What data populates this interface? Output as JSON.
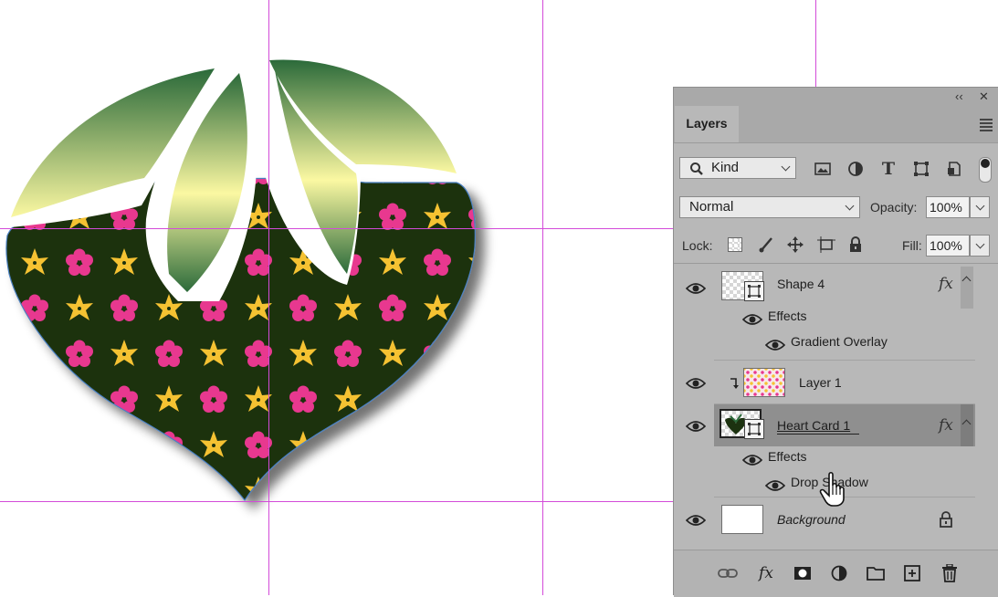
{
  "panel": {
    "title": "Layers",
    "collapse_glyph": "‹‹",
    "close_glyph": "✕",
    "filter_kind": "Kind",
    "blend_mode": "Normal",
    "opacity_label": "Opacity:",
    "opacity_value": "100%",
    "lock_label": "Lock:",
    "fill_label": "Fill:",
    "fill_value": "100%"
  },
  "layers": [
    {
      "name": "Shape 4",
      "fx": "fx",
      "effects_label": "Effects",
      "effect": "Gradient Overlay"
    },
    {
      "name": "Layer 1"
    },
    {
      "name": "Heart Card 1",
      "fx": "fx",
      "effects_label": "Effects",
      "effect": "Drop Shadow",
      "selected": true
    },
    {
      "name": "Background",
      "locked": true
    }
  ],
  "colors": {
    "guide": "#d34bd9",
    "heart_fill": "#1c3210",
    "flower_pink": "#e8378f",
    "flower_yellow": "#f5c233",
    "leaf_dark": "#2b6a3a",
    "leaf_light": "#fbf8a2"
  },
  "icons": [
    "search-icon",
    "image-filter-icon",
    "adjustment-filter-icon",
    "type-filter-icon",
    "shape-filter-icon",
    "smart-object-filter-icon",
    "lock-transparent-icon",
    "lock-paint-icon",
    "lock-move-icon",
    "lock-artboard-icon",
    "lock-all-icon",
    "link-icon",
    "fx-icon",
    "mask-icon",
    "adjustment-icon",
    "folder-icon",
    "new-layer-icon",
    "trash-icon",
    "hand-cursor-icon"
  ]
}
